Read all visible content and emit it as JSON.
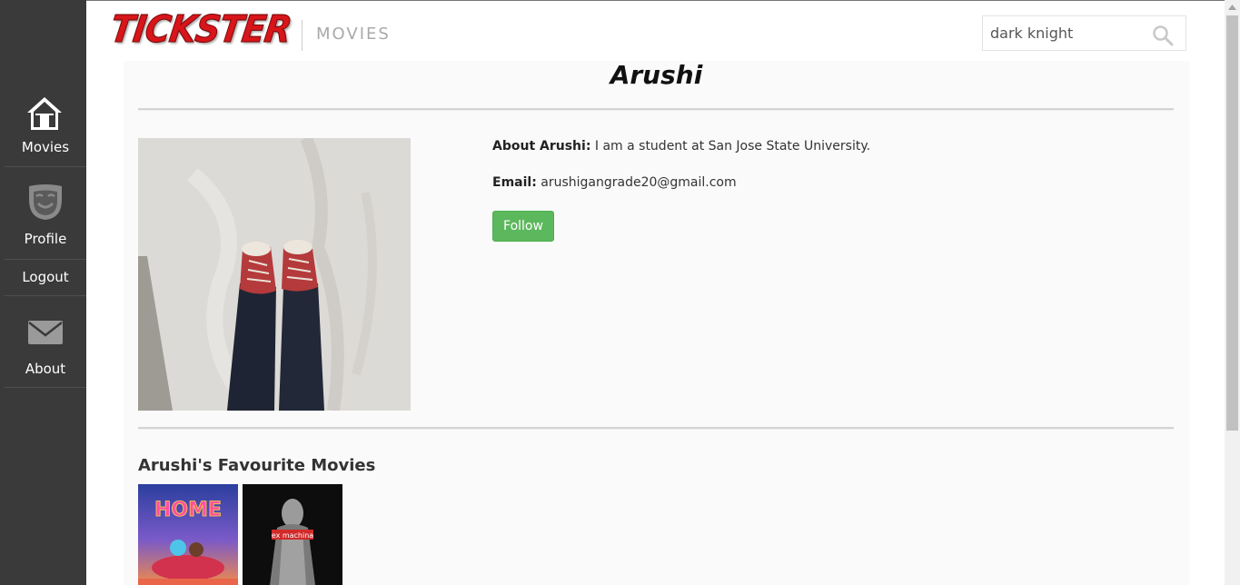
{
  "sidebar": {
    "items": [
      {
        "label": "Movies",
        "icon": "home-icon"
      },
      {
        "label": "Profile",
        "icon": "mask-icon"
      },
      {
        "label": "Logout"
      },
      {
        "label": "About",
        "icon": "envelope-icon"
      }
    ]
  },
  "header": {
    "logo_text": "TICKSTER",
    "section_title": "MOVIES",
    "search_value": "dark knight"
  },
  "profile": {
    "name": "Arushi",
    "about_label": "About Arushi:",
    "about_text": " I am a student at San Jose State University.",
    "email_label": "Email:",
    "email_text": " arushigangrade20@gmail.com",
    "follow_label": "Follow"
  },
  "favourites": {
    "title": "Arushi's Favourite Movies",
    "posters": [
      {
        "title": "HOME"
      },
      {
        "title": "ex machina"
      }
    ]
  },
  "colors": {
    "sidebar": "#3a3a3a",
    "logo": "#d8151a",
    "follow_button": "#5cb85c"
  }
}
